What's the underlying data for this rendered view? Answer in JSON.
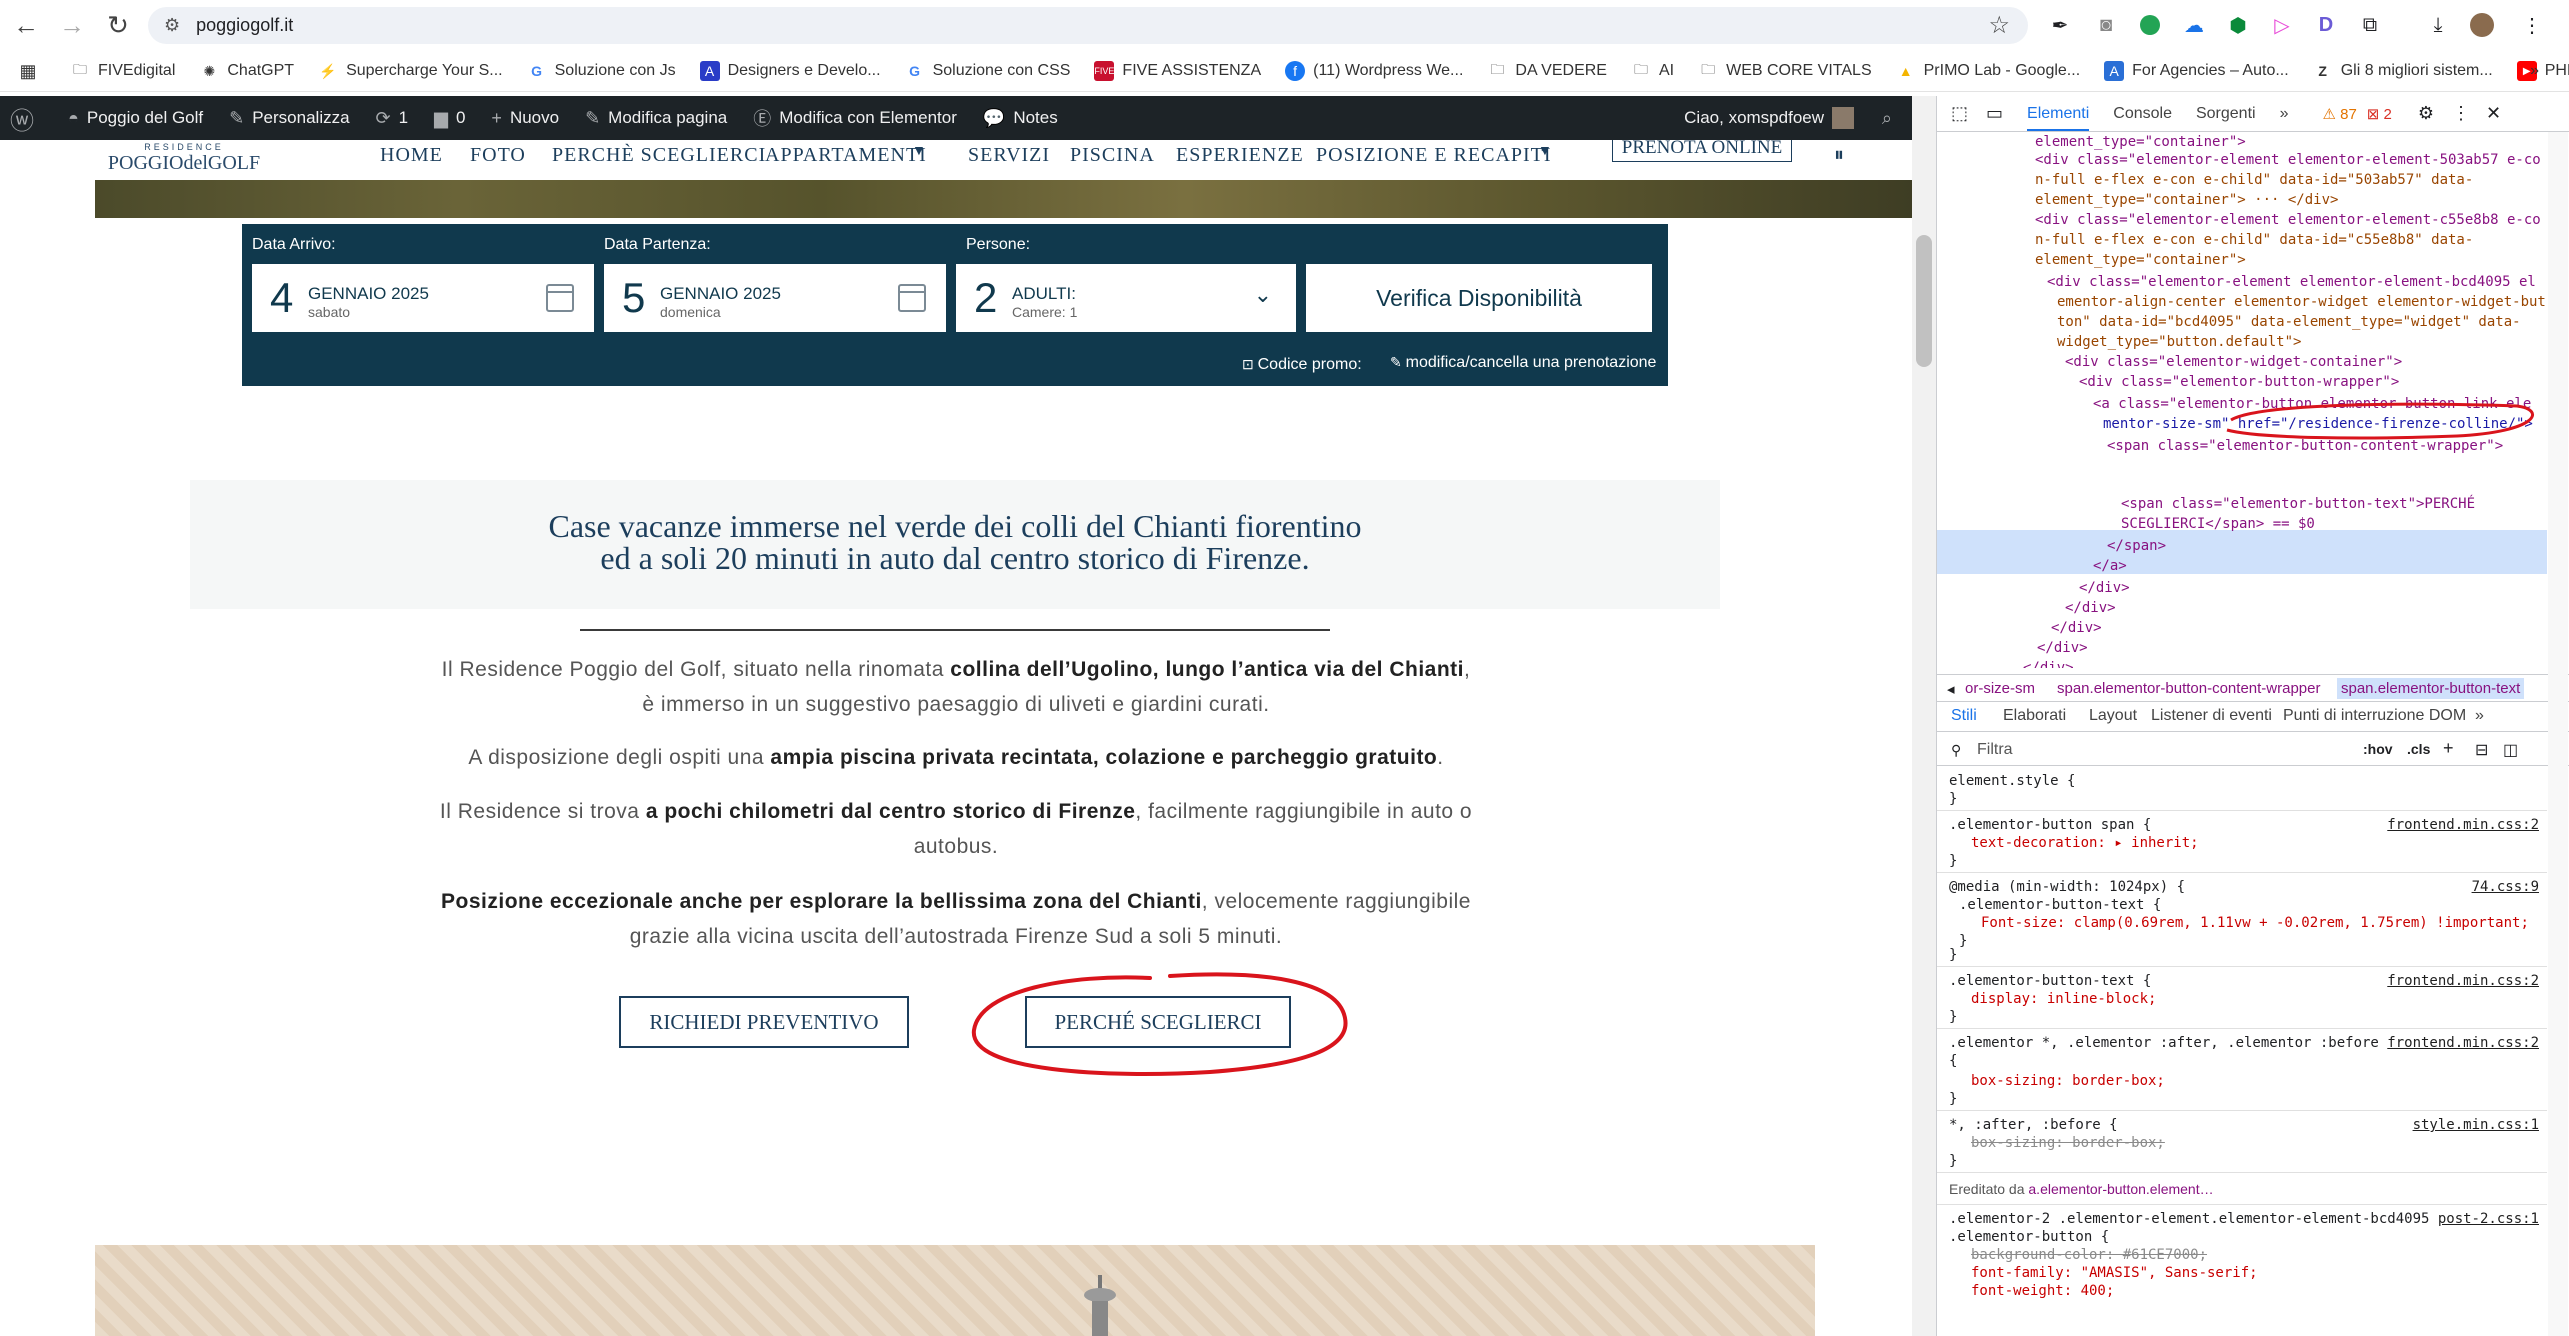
{
  "browser": {
    "url": "poggiogolf.it",
    "bookmarks": [
      "FIVEdigital",
      "ChatGPT",
      "Supercharge Your S...",
      "Soluzione con Js",
      "Designers e Develo...",
      "Soluzione con CSS",
      "FIVE ASSISTENZA",
      "(11) Wordpress We...",
      "DA VEDERE",
      "AI",
      "WEB CORE VITALS",
      "PrIMO Lab - Google...",
      "For Agencies – Auto...",
      "Gli 8 migliori sistem...",
      "PHP corso OK"
    ]
  },
  "wpbar": {
    "site": "Poggio del Golf",
    "customize": "Personalizza",
    "updates": "1",
    "comments": "0",
    "new": "Nuovo",
    "edit": "Modifica pagina",
    "elementor": "Modifica con Elementor",
    "notes": "Notes",
    "greeting": "Ciao, xomspdfoew"
  },
  "site": {
    "logo_small": "RESIDENCE",
    "logo_big": "POGGIOdelGOLF",
    "nav": [
      "HOME",
      "FOTO",
      "PERCHÈ SCEGLIERCI",
      "APPARTAMENTI",
      "SERVIZI",
      "PISCINA",
      "ESPERIENZE",
      "POSIZIONE E RECAPITI"
    ],
    "cta": "PRENOTA ONLINE"
  },
  "booking": {
    "arrival_label": "Data Arrivo:",
    "arrival_day": "4",
    "arrival_month": "GENNAIO 2025",
    "arrival_weekday": "sabato",
    "departure_label": "Data Partenza:",
    "departure_day": "5",
    "departure_month": "GENNAIO 2025",
    "departure_weekday": "domenica",
    "people_label": "Persone:",
    "people_count": "2",
    "people_type": "ADULTI:",
    "rooms": "Camere: 1",
    "check": "Verifica Disponibilità",
    "promo": "Codice promo:",
    "modify": "modifica/cancella una prenotazione"
  },
  "intro": {
    "line1": "Case vacanze immerse nel verde dei colli del Chianti fiorentino",
    "line2": "ed a soli 20 minuti in auto dal centro storico di Firenze.",
    "p1a": "Il Residence Poggio del Golf, situato nella rinomata ",
    "p1b": "collina dell’Ugolino, lungo l’antica via del Chianti",
    "p1c": ",",
    "p1d": "è immerso in un suggestivo paesaggio di uliveti e giardini curati.",
    "p2a": "A disposizione degli ospiti una ",
    "p2b": "ampia piscina privata recintata, colazione e parcheggio gratuito",
    "p2c": ".",
    "p3a": "Il Residence si trova ",
    "p3b": "a pochi chilometri dal centro storico di Firenze",
    "p3c": ", facilmente raggiungibile in auto o",
    "p3d": "autobus.",
    "p4a": "Posizione eccezionale anche per esplorare la bellissima zona del Chianti",
    "p4b": ", velocemente raggiungibile",
    "p4c": "grazie alla vicina uscita dell’autostrada Firenze Sud a soli 5 minuti.",
    "btn_quote": "RICHIEDI PREVENTIVO",
    "btn_why": "PERCHÉ SCEGLIERCI"
  },
  "devtools": {
    "tabs": [
      "Elementi",
      "Console",
      "Sorgenti"
    ],
    "warnings": "87",
    "errors": "2",
    "dom": [
      "element_type=\"container\">",
      "<div class=\"elementor-element elementor-element-503ab57 e-co",
      "n-full e-flex e-con e-child\" data-id=\"503ab57\" data-",
      "element_type=\"container\"> ··· </div>",
      "<div class=\"elementor-element elementor-element-c55e8b8 e-co",
      "n-full e-flex e-con e-child\" data-id=\"c55e8b8\" data-",
      "element_type=\"container\">",
      "<div class=\"elementor-element elementor-element-bcd4095 el",
      "ementor-align-center elementor-widget elementor-widget-but",
      "ton\" data-id=\"bcd4095\" data-element_type=\"widget\" data-",
      "widget_type=\"button.default\">",
      "<div class=\"elementor-widget-container\">",
      "<div class=\"elementor-button-wrapper\">",
      "<a class=\"elementor-button elementor-button-link ele",
      "mentor-size-sm\" href=\"/residence-firenze-colline/\">",
      "<span class=\"elementor-button-content-wrapper\">",
      "<span class=\"elementor-button-text\">PERCHÉ",
      "SCEGLIERCI</span> == $0",
      "</span>",
      "</a>",
      "</div>",
      "</div>",
      "</div>",
      "</div>",
      "</div>"
    ],
    "crumbs": [
      "or-size-sm",
      "span.elementor-button-content-wrapper",
      "span.elementor-button-text"
    ],
    "style_tabs": [
      "Stili",
      "Elaborati",
      "Layout",
      "Listener di eventi",
      "Punti di interruzione DOM"
    ],
    "filter_placeholder": "Filtra",
    "filter_hov": ":hov",
    "filter_cls": ".cls",
    "rules": [
      {
        "sel": "element.style {",
        "props": [],
        "src": ""
      },
      {
        "sel": ".elementor-button span {",
        "props": [
          "text-decoration: ▸ inherit;"
        ],
        "src": "frontend.min.css:2"
      },
      {
        "sel": "@media (min-width: 1024px) {",
        "sub": ".elementor-button-text {",
        "props": [
          "Font-size: clamp(0.69rem, 1.11vw + -0.02rem, 1.75rem) !important;"
        ],
        "src": "74.css:9"
      },
      {
        "sel": ".elementor-button-text {",
        "props": [
          "display: inline-block;"
        ],
        "src": "frontend.min.css:2"
      },
      {
        "sel": ".elementor *, .elementor :after, .elementor :before",
        "props": [
          "box-sizing: border-box;"
        ],
        "src": "frontend.min.css:2"
      },
      {
        "sel": "*, :after, :before {",
        "props": [
          "box-sizing: border-box;"
        ],
        "src": "style.min.css:1"
      }
    ],
    "inherited": "Ereditato da",
    "inherited_from": "a.elementor-button.element…",
    "rule2_sel1": ".elementor-2 .elementor-element.elementor-element-bcd4095",
    "rule2_sel2": ".elementor-button {",
    "rule2_src": "post-2.css:1",
    "rule2_props": [
      "background-color: #61CE7000;",
      "font-family: \"AMASIS\", Sans-serif;",
      "font-weight: 400;"
    ]
  },
  "colors": {
    "booking_bg": "#10394d",
    "navy": "#1c3e5c",
    "annotation": "#d9141c",
    "wp_bar": "#1d2327"
  }
}
